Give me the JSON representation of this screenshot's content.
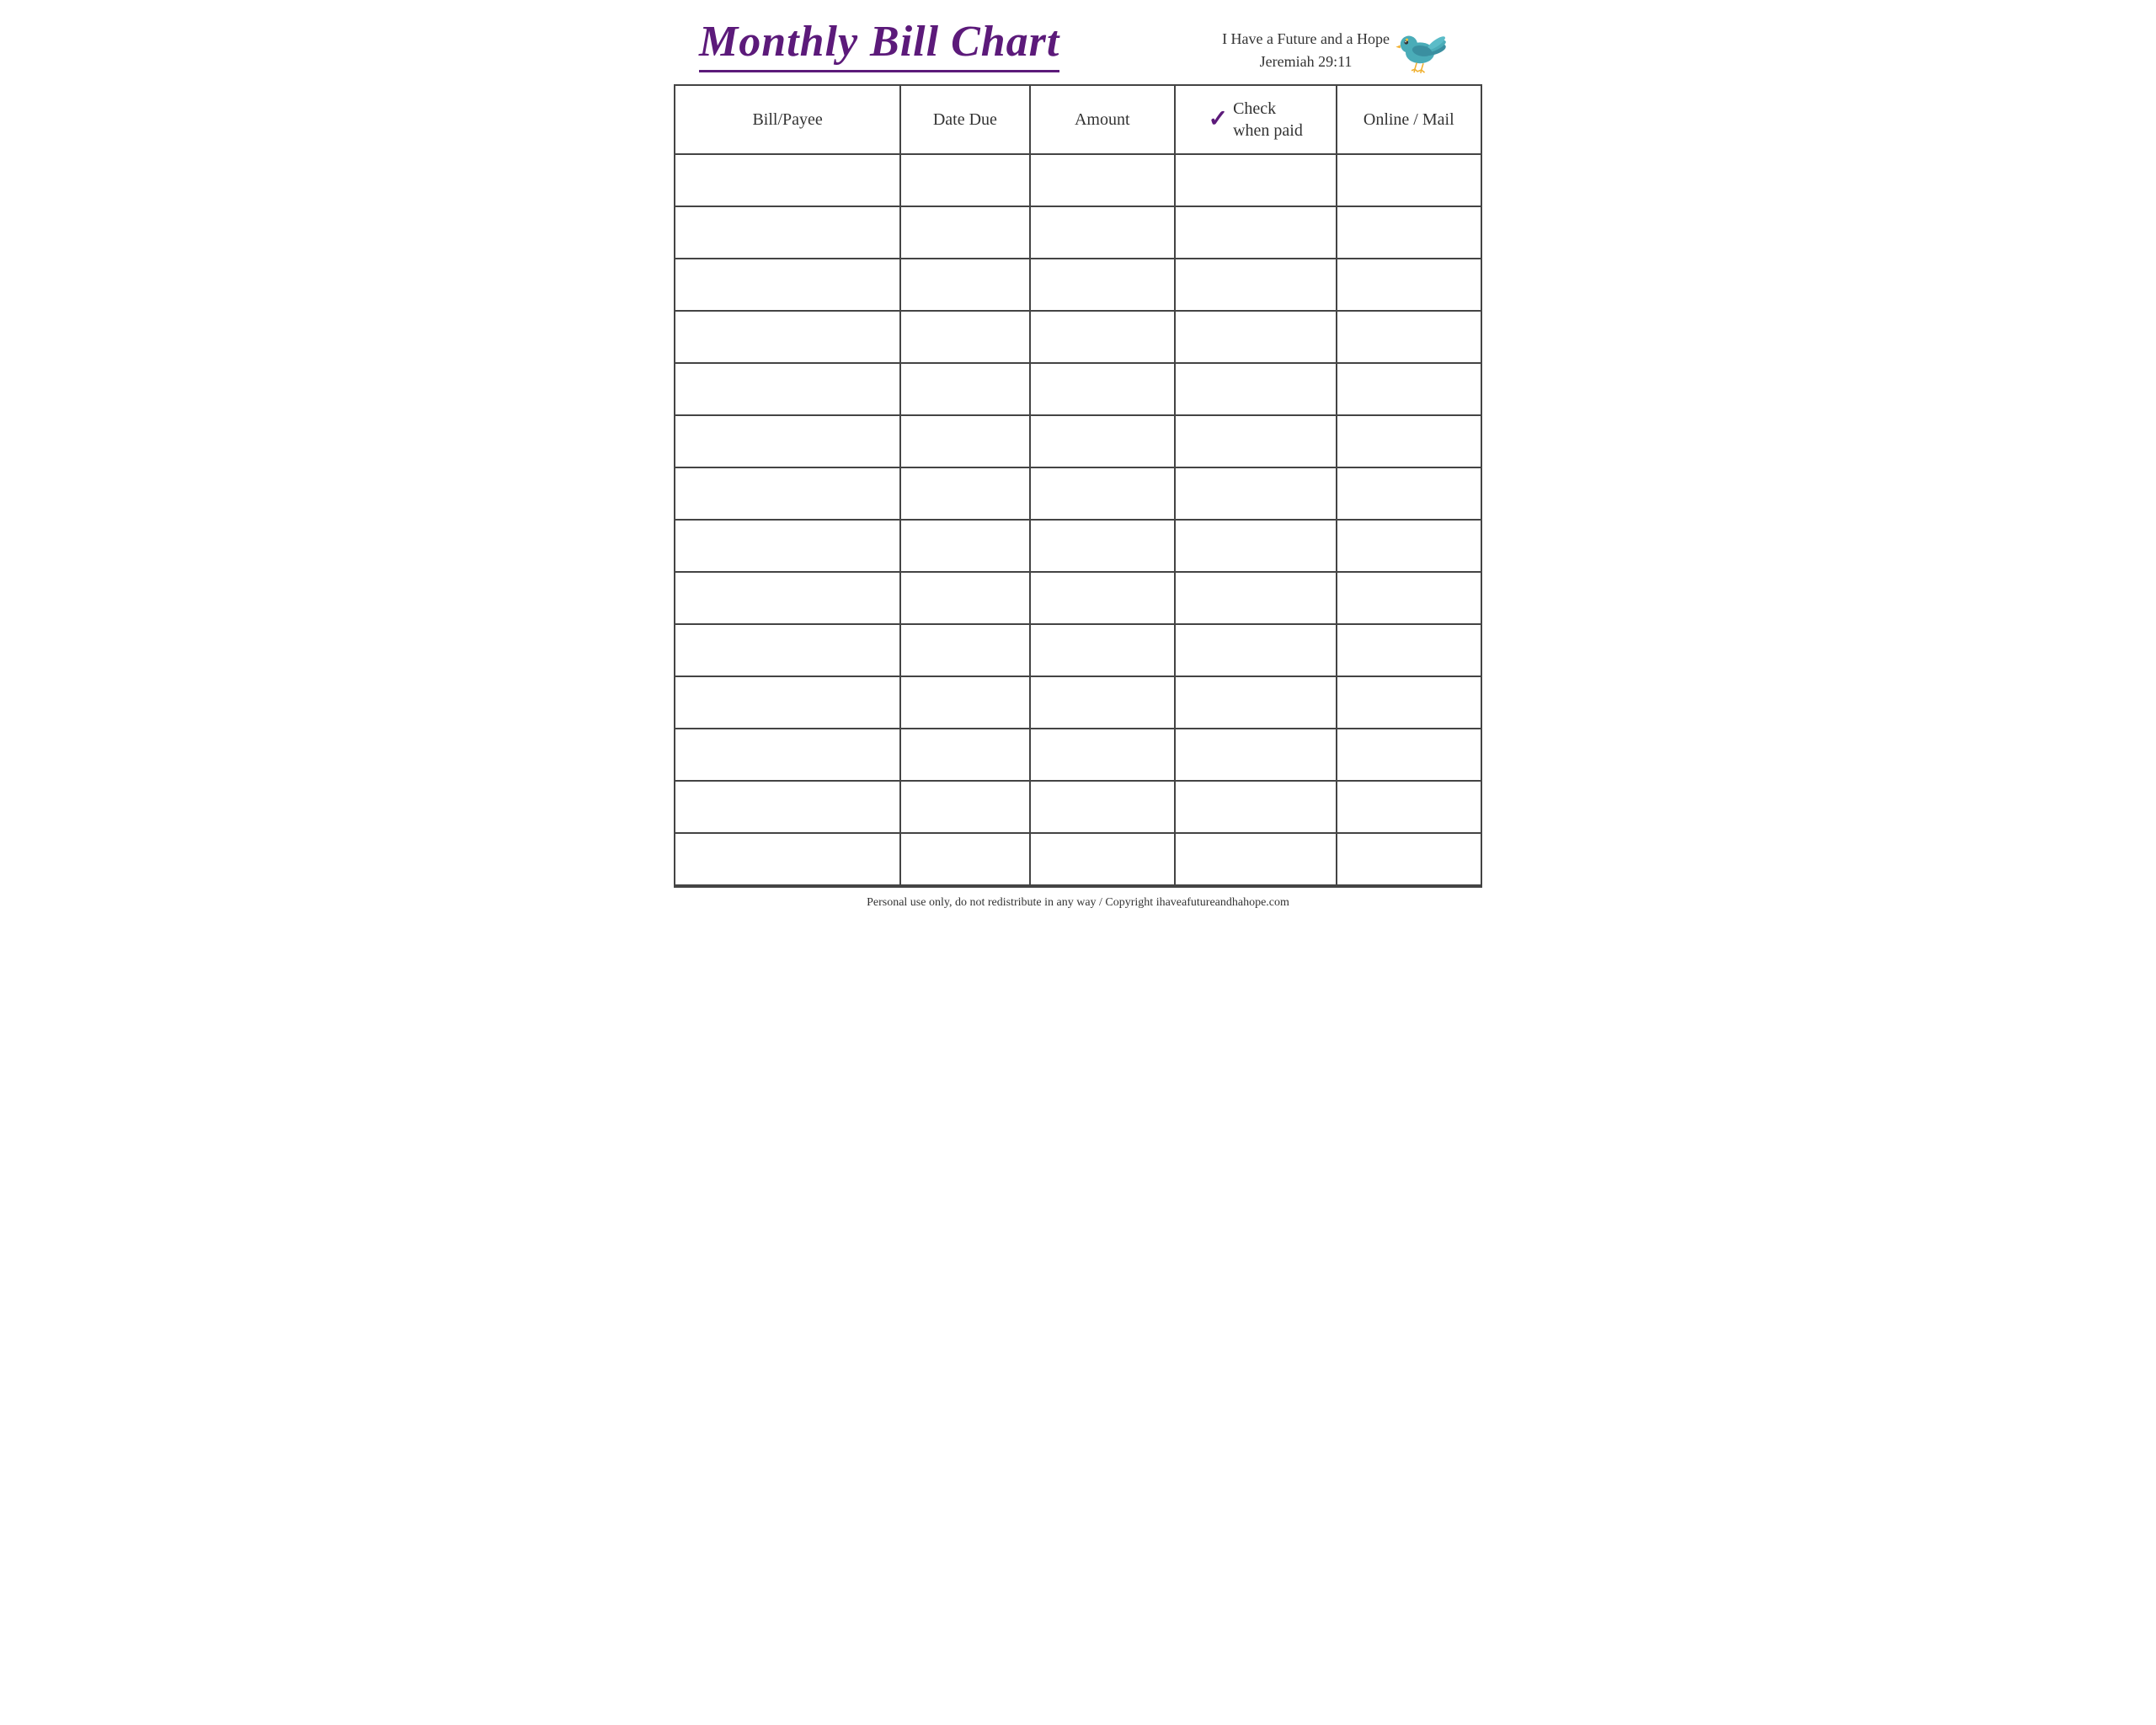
{
  "header": {
    "title": "Monthly Bill Chart",
    "tagline_line1": "I Have a Future and a Hope",
    "tagline_line2": "Jeremiah 29:11"
  },
  "table": {
    "columns": [
      {
        "id": "bill-payee",
        "label": "Bill/Payee"
      },
      {
        "id": "date-due",
        "label": "Date Due"
      },
      {
        "id": "amount",
        "label": "Amount"
      },
      {
        "id": "check-when-paid",
        "label_line1": "Check",
        "label_line2": "when paid"
      },
      {
        "id": "online-mail",
        "label": "Online / Mail"
      }
    ],
    "row_count": 14
  },
  "footer": {
    "text": "Personal use only, do not redistribute in any way / Copyright ihaveafutureandhahope.com"
  }
}
